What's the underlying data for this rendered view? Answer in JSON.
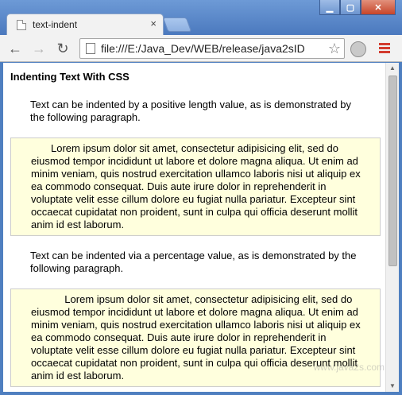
{
  "browser": {
    "tab_title": "text-indent",
    "tab_close": "×",
    "url": "file:///E:/Java_Dev/WEB/release/java2sID",
    "window_controls": {
      "minimize": "▁",
      "maximize": "▢",
      "close": "✕"
    },
    "icons": {
      "back": "←",
      "forward": "→",
      "reload": "↻",
      "star": "☆"
    }
  },
  "page": {
    "heading": "Indenting Text With CSS",
    "intro_length": "Text can be indented by a positive length value, as is demonstrated by the following paragraph.",
    "lorem_length": "Lorem ipsum dolor sit amet, consectetur adipisicing elit, sed do eiusmod tempor incididunt ut labore et dolore magna aliqua. Ut enim ad minim veniam, quis nostrud exercitation ullamco laboris nisi ut aliquip ex ea commodo consequat. Duis aute irure dolor in reprehenderit in voluptate velit esse cillum dolore eu fugiat nulla pariatur. Excepteur sint occaecat cupidatat non proident, sunt in culpa qui officia deserunt mollit anim id est laborum.",
    "intro_percent": "Text can be indented via a percentage value, as is demonstrated by the following paragraph.",
    "lorem_percent": "Lorem ipsum dolor sit amet, consectetur adipisicing elit, sed do eiusmod tempor incididunt ut labore et dolore magna aliqua. Ut enim ad minim veniam, quis nostrud exercitation ullamco laboris nisi ut aliquip ex ea commodo consequat. Duis aute irure dolor in reprehenderit in voluptate velit esse cillum dolore eu fugiat nulla pariatur. Excepteur sint occaecat cupidatat non proident, sunt in culpa qui officia deserunt mollit anim id est laborum.",
    "watermark": "www.java2s.com"
  },
  "colors": {
    "lorem_background": "#ffffdd",
    "titlebar": "#4f7fc0"
  }
}
